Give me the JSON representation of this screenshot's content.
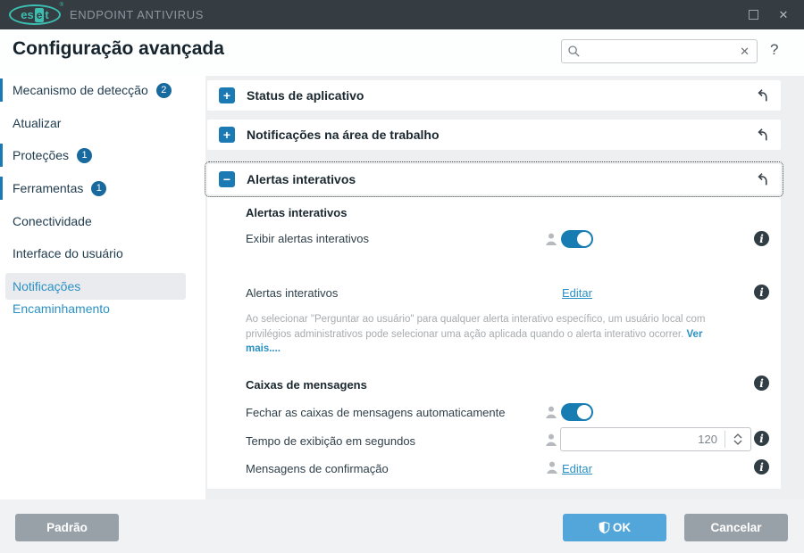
{
  "titlebar": {
    "brand": "ENDPOINT ANTIVIRUS",
    "logo": {
      "left": "es",
      "mid": "e",
      "right": "t",
      "reg": "®"
    },
    "close_glyph": "✕"
  },
  "header": {
    "title": "Configuração avançada",
    "search_placeholder": "",
    "clear_glyph": "✕",
    "help_label": "?"
  },
  "sidebar": {
    "items": [
      {
        "label": "Mecanismo de detecção",
        "badge": "2"
      },
      {
        "label": "Atualizar"
      },
      {
        "label": "Proteções",
        "badge": "1"
      },
      {
        "label": "Ferramentas",
        "badge": "1"
      },
      {
        "label": "Conectividade"
      },
      {
        "label": "Interface do usuário"
      },
      {
        "label": "Notificações"
      },
      {
        "label": "Encaminhamento"
      }
    ]
  },
  "sections": [
    {
      "label": "Status de aplicativo",
      "toggle_glyph": "+"
    },
    {
      "label": "Notificações na área de trabalho",
      "toggle_glyph": "+"
    },
    {
      "label": "Alertas interativos",
      "toggle_glyph": "−"
    }
  ],
  "panel": {
    "group1_title": "Alertas interativos",
    "exibir_label": "Exibir alertas interativos",
    "alertas_label": "Alertas interativos",
    "editar_label": "Editar",
    "note_text": "Ao selecionar \"Perguntar ao usuário\" para qualquer alerta interativo específico, um usuário local com privilégios administrativos pode selecionar uma ação aplicada quando o alerta interativo ocorrer.",
    "note_link": "Ver mais....",
    "group2_title": "Caixas de mensagens",
    "fechar_label": "Fechar as caixas de mensagens automaticamente",
    "tempo_label": "Tempo de exibição em segundos",
    "tempo_value": "120",
    "mensagens_label": "Mensagens de confirmação",
    "editar2_label": "Editar"
  },
  "footer": {
    "default_label": "Padrão",
    "ok_label": "OK",
    "cancel_label": "Cancelar"
  },
  "colors": {
    "accent_teal": "#3cbfb0",
    "accent_blue": "#1b7ab3",
    "link_blue": "#2b91c4",
    "toggle_on": "#177cb2",
    "ok_button": "#53a6d9",
    "gray_button": "#99a1a8",
    "titlebar_bg": "#353d43",
    "content_bg": "#edeff1"
  }
}
